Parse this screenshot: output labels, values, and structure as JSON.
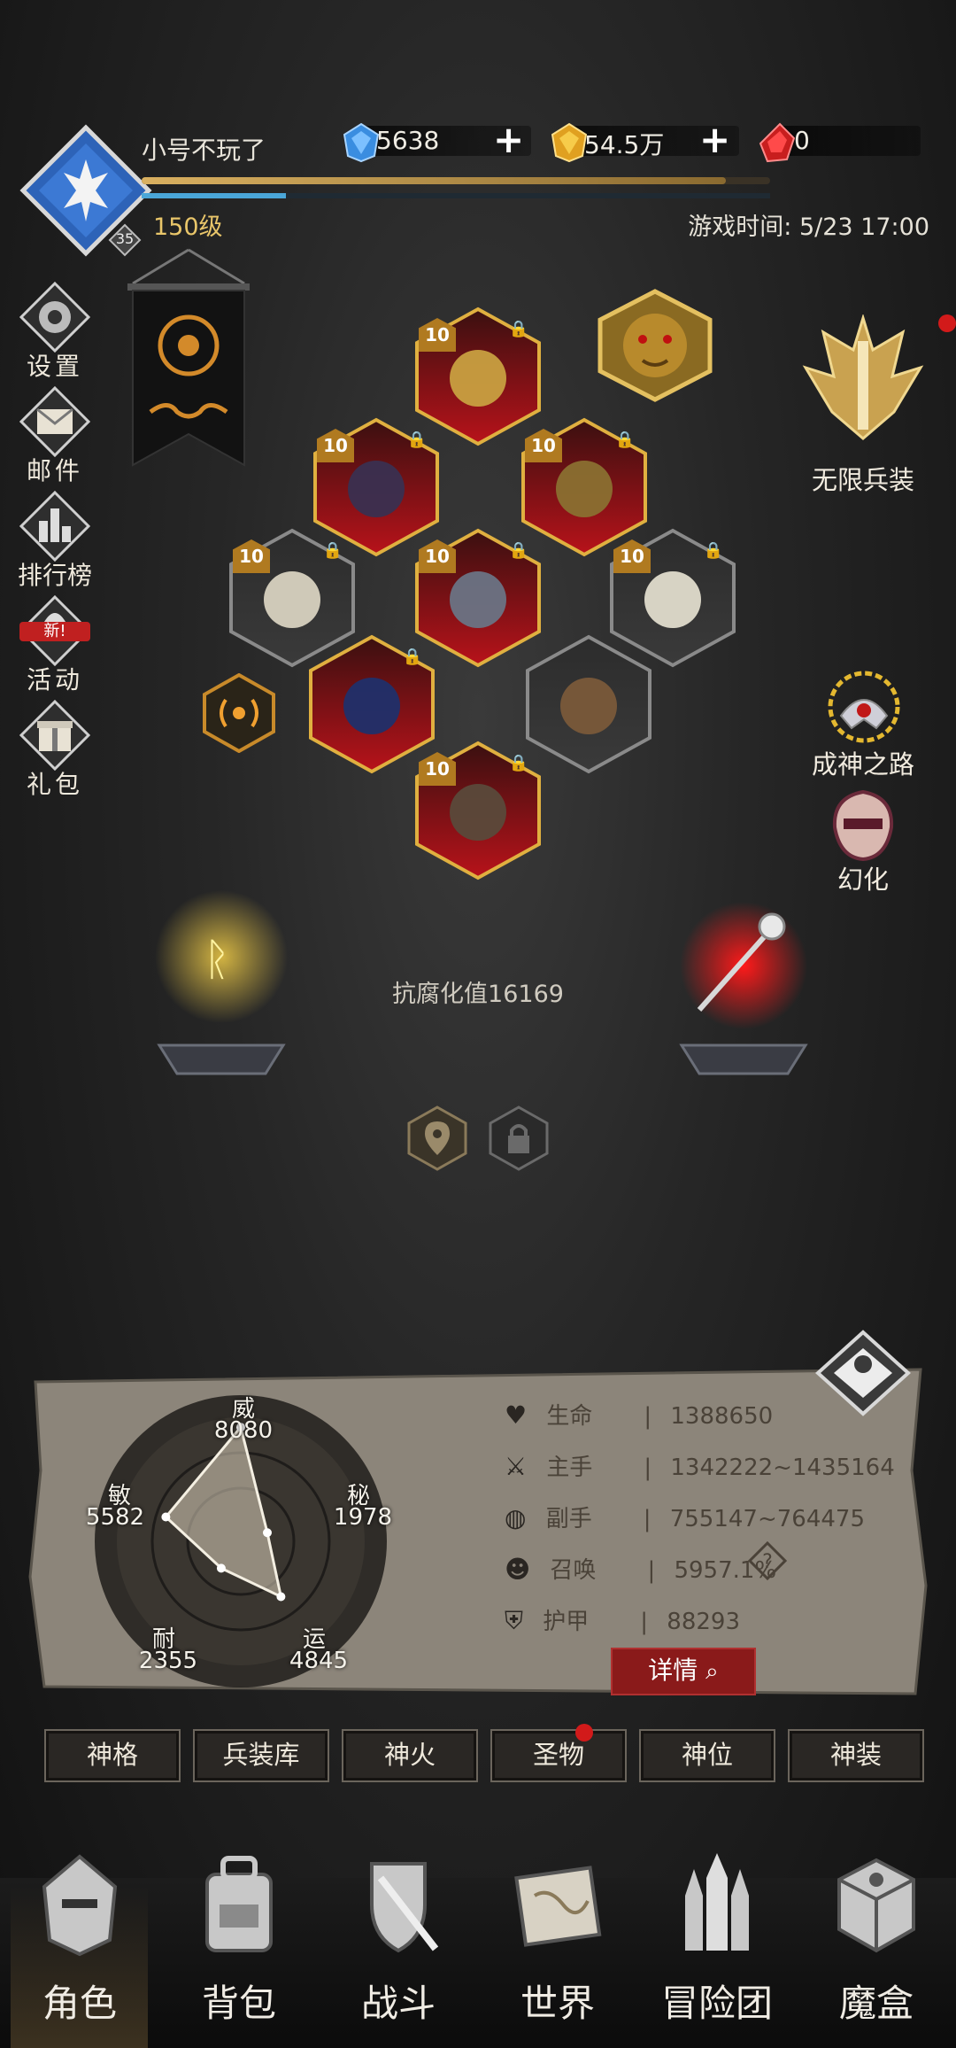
{
  "player": {
    "name": "小号不玩了",
    "level_text": "150级",
    "avatar_badge": "35",
    "exp_fraction": 0.93,
    "hp_fraction": 0.23
  },
  "currencies": [
    {
      "name": "blue-gem",
      "value": "5638",
      "color": "#3a8de0"
    },
    {
      "name": "gold-gem",
      "value": "54.5万",
      "color": "#e0a020"
    },
    {
      "name": "red-gem",
      "value": "0",
      "color": "#d02020"
    }
  ],
  "game_time": "游戏时间: 5/23 17:00",
  "left_menu": [
    {
      "id": "settings",
      "label": "设置",
      "icon": "gear-icon"
    },
    {
      "id": "mail",
      "label": "邮件",
      "icon": "mail-icon"
    },
    {
      "id": "ranking",
      "label": "排行榜",
      "icon": "ranking-icon"
    },
    {
      "id": "activity",
      "label": "活动",
      "icon": "activity-icon",
      "badge": "新!"
    },
    {
      "id": "gift",
      "label": "礼包",
      "icon": "gift-icon"
    }
  ],
  "right_menu": [
    {
      "id": "infinite-armory",
      "label": "无限兵装",
      "icon": "infinite-armory-icon"
    },
    {
      "id": "godhood-path",
      "label": "成神之路",
      "icon": "godhood-path-icon"
    },
    {
      "id": "transform",
      "label": "幻化",
      "icon": "transform-icon"
    }
  ],
  "equipment": [
    {
      "slot": "crown",
      "level": "10",
      "locked": true
    },
    {
      "slot": "gloves",
      "level": "10",
      "locked": true
    },
    {
      "slot": "ring-box",
      "level": "10",
      "locked": true
    },
    {
      "slot": "belt",
      "level": "10",
      "locked": true
    },
    {
      "slot": "chest-armor",
      "level": "10",
      "locked": true
    },
    {
      "slot": "cloak",
      "level": "10",
      "locked": true
    },
    {
      "slot": "main-weapon",
      "level": "",
      "locked": true
    },
    {
      "slot": "orb",
      "level": "",
      "locked": false
    },
    {
      "slot": "boots",
      "level": "10",
      "locked": true
    }
  ],
  "corruption_resist": "抗腐化值16169",
  "stats": {
    "radar": [
      {
        "name": "威",
        "value": "8080"
      },
      {
        "name": "秘",
        "value": "1978"
      },
      {
        "name": "运",
        "value": "4845"
      },
      {
        "name": "耐",
        "value": "2355"
      },
      {
        "name": "敏",
        "value": "5582"
      }
    ],
    "rows": [
      {
        "label": "生命",
        "value": "1388650",
        "icon": "heart-icon"
      },
      {
        "label": "主手",
        "value": "1342222~1435164",
        "icon": "sword-icon"
      },
      {
        "label": "副手",
        "value": "755147~764475",
        "icon": "offhand-icon"
      },
      {
        "label": "召唤",
        "value": "5957.1%",
        "icon": "summon-icon"
      },
      {
        "label": "护甲",
        "value": "88293",
        "icon": "armor-icon"
      }
    ],
    "details_label": "详情"
  },
  "tabs": [
    "神格",
    "兵装库",
    "神火",
    "圣物",
    "神位",
    "神装"
  ],
  "bottom_nav": [
    {
      "label": "角色",
      "icon": "helmet-icon",
      "active": true
    },
    {
      "label": "背包",
      "icon": "backpack-icon",
      "active": false
    },
    {
      "label": "战斗",
      "icon": "sword-shield-icon",
      "active": false
    },
    {
      "label": "世界",
      "icon": "map-scroll-icon",
      "active": false
    },
    {
      "label": "冒险团",
      "icon": "castle-icon",
      "active": false
    },
    {
      "label": "魔盒",
      "icon": "magic-box-icon",
      "active": false
    }
  ]
}
